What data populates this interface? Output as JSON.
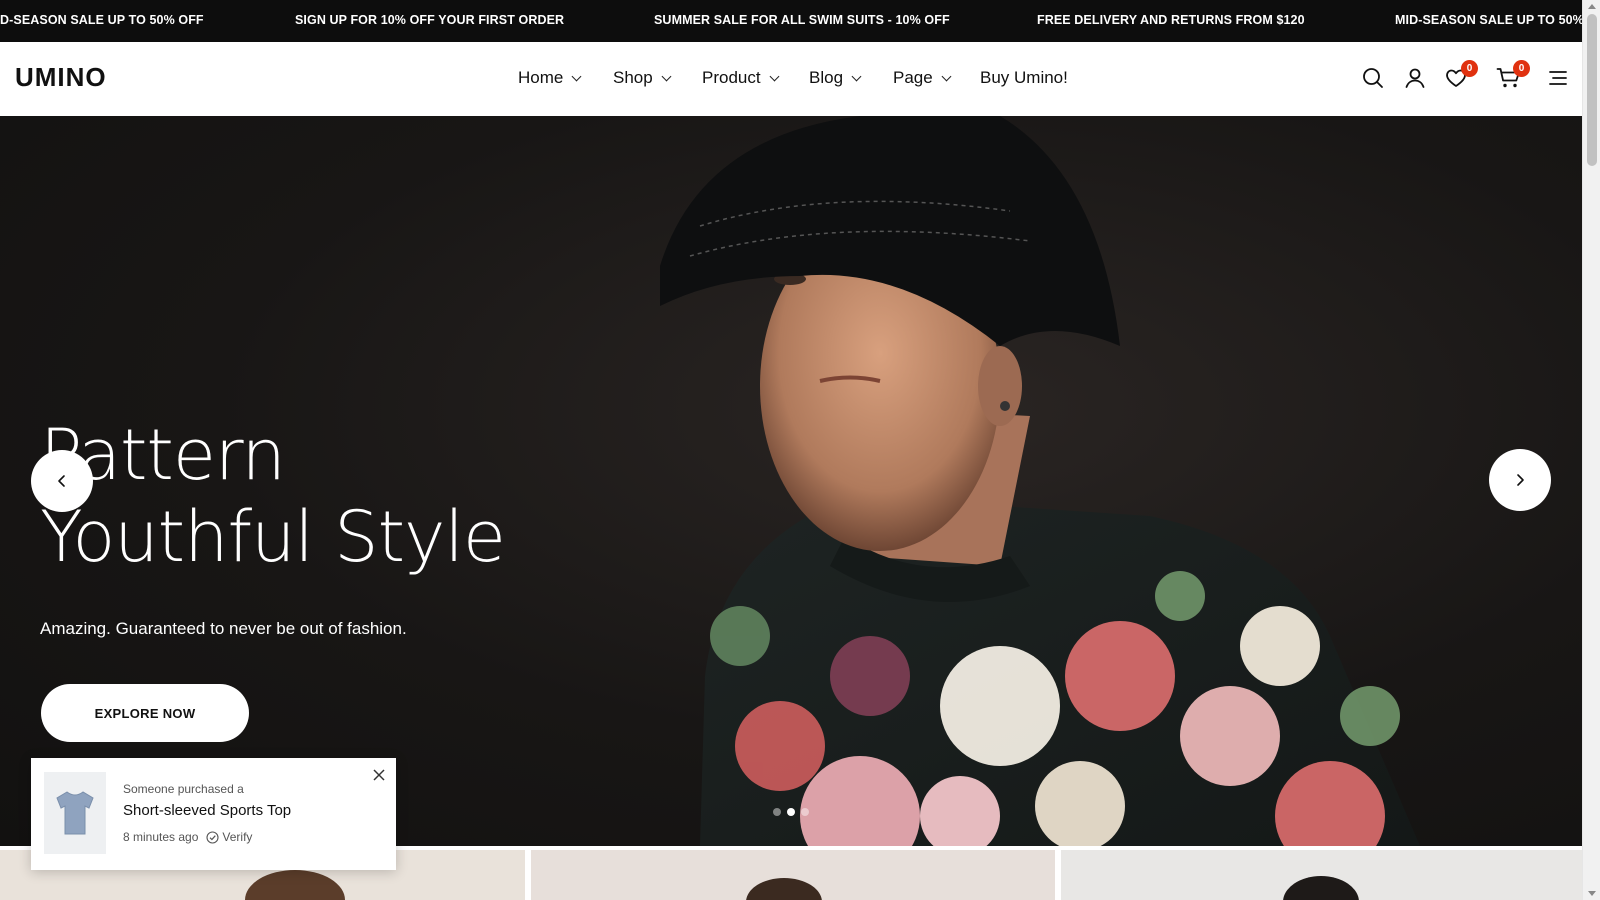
{
  "announcements": [
    "D-SEASON SALE UP TO 50% OFF",
    "SIGN UP FOR 10% OFF YOUR FIRST ORDER",
    "SUMMER SALE FOR ALL SWIM SUITS - 10% OFF",
    "FREE DELIVERY AND RETURNS FROM $120",
    "MID-SEASON SALE UP TO 50% O"
  ],
  "header": {
    "logo": "UMINO",
    "nav": [
      {
        "label": "Home"
      },
      {
        "label": "Shop"
      },
      {
        "label": "Product"
      },
      {
        "label": "Blog"
      },
      {
        "label": "Page"
      },
      {
        "label": "Buy Umino!"
      }
    ],
    "icons": [
      "search-icon",
      "user-icon",
      "heart-icon",
      "cart-icon",
      "menu-icon"
    ],
    "wishlist_count": "0",
    "cart_count": "0",
    "badge_color": "#e0310f"
  },
  "hero": {
    "title_line1": "Pattern",
    "title_line2": "Youthful Style",
    "subtitle": "Amazing. Guaranteed to never be out of fashion.",
    "cta": "EXPLORE NOW",
    "slide_count": 3,
    "active_slide": 2
  },
  "toast": {
    "line1": "Someone purchased a",
    "product": "Short-sleeved Sports Top",
    "time": "8  minutes ago",
    "verify": "Verify"
  }
}
